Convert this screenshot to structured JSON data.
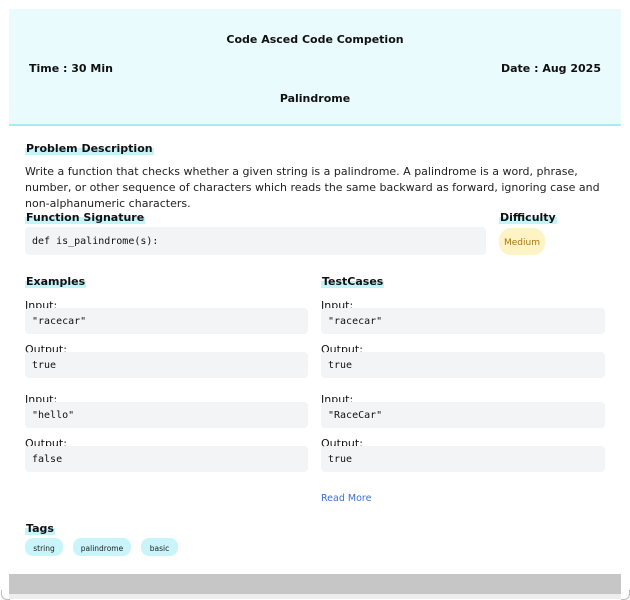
{
  "header": {
    "title": "Code Asced Code Competion",
    "time": "Time : 30 Min",
    "date": "Date : Aug 2025",
    "problem_name": "Palindrome"
  },
  "description": {
    "heading": "Problem Description",
    "text": "Write a function that checks whether a given string is a palindrome. A palindrome is a word, phrase, number, or other sequence of characters which reads the same backward as forward, ignoring case and non-alphanumeric characters."
  },
  "signature": {
    "heading": "Function Signature",
    "code": "def is_palindrome(s):"
  },
  "difficulty": {
    "heading": "Difficulty",
    "value": "Medium"
  },
  "examples": {
    "heading": "Examples",
    "items": [
      {
        "input_label": "Input:",
        "input": "\"racecar\"",
        "output_label": "Output:",
        "output": "true"
      },
      {
        "input_label": "Input:",
        "input": "\"hello\"",
        "output_label": "Output:",
        "output": "false"
      }
    ]
  },
  "testcases": {
    "heading": "TestCases",
    "items": [
      {
        "input_label": "Input:",
        "input": "\"racecar\"",
        "output_label": "Output:",
        "output": "true"
      },
      {
        "input_label": "Input:",
        "input": "\"RaceCar\"",
        "output_label": "Output:",
        "output": "true"
      }
    ],
    "read_more": "Read More"
  },
  "tags": {
    "heading": "Tags",
    "items": [
      "string",
      "palindrome",
      "basic"
    ]
  },
  "colors": {
    "header_bg": "#e9fbfd",
    "header_border": "#a6ecf3",
    "highlight": "#c4f3f8",
    "code_bg": "#f3f4f6",
    "difficulty_bg": "#fdf3c4",
    "difficulty_text": "#a87a12",
    "link": "#3b6fd4",
    "tag_bg": "#c9f4f9"
  }
}
